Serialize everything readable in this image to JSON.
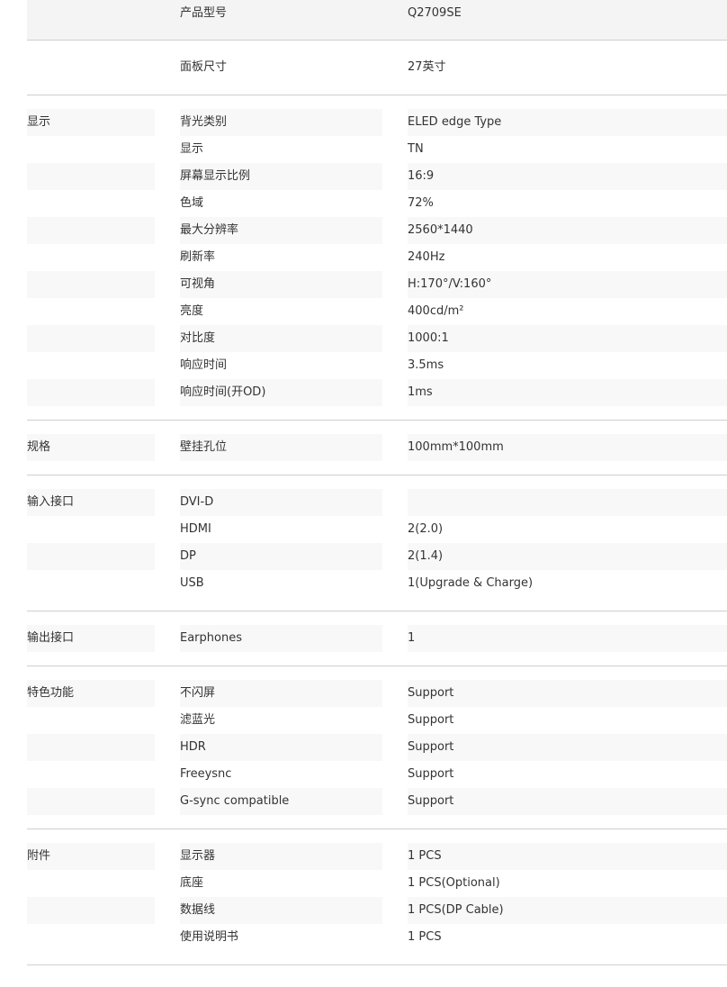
{
  "top_row": {
    "label": "产品型号",
    "value": "Q2709SE"
  },
  "panel_row": {
    "label": "面板尺寸",
    "value": "27英寸"
  },
  "sections": [
    {
      "category": "显示",
      "rows": [
        {
          "label": "背光类别",
          "value": "ELED edge Type"
        },
        {
          "label": "显示",
          "value": "TN"
        },
        {
          "label": "屏幕显示比例",
          "value": "16:9"
        },
        {
          "label": "色域",
          "value": "72%"
        },
        {
          "label": "最大分辨率",
          "value": "2560*1440"
        },
        {
          "label": "刷新率",
          "value": "240Hz"
        },
        {
          "label": "可视角",
          "value": "H:170°/V:160°"
        },
        {
          "label": "亮度",
          "value": "400cd/m²"
        },
        {
          "label": "对比度",
          "value": "1000:1"
        },
        {
          "label": "响应时间",
          "value": "3.5ms"
        },
        {
          "label": "响应时间(开OD)",
          "value": "1ms"
        }
      ]
    },
    {
      "category": "规格",
      "rows": [
        {
          "label": "壁挂孔位",
          "value": "100mm*100mm"
        }
      ]
    },
    {
      "category": "输入接口",
      "rows": [
        {
          "label": "DVI-D",
          "value": ""
        },
        {
          "label": "HDMI",
          "value": "2(2.0)"
        },
        {
          "label": "DP",
          "value": "2(1.4)"
        },
        {
          "label": "USB",
          "value": "1(Upgrade & Charge)"
        }
      ]
    },
    {
      "category": "输出接口",
      "rows": [
        {
          "label": "Earphones",
          "value": "1"
        }
      ]
    },
    {
      "category": "特色功能",
      "rows": [
        {
          "label": "不闪屏",
          "value": "Support"
        },
        {
          "label": "滤蓝光",
          "value": "Support"
        },
        {
          "label": "HDR",
          "value": "Support"
        },
        {
          "label": "Freeysnc",
          "value": "Support"
        },
        {
          "label": "G-sync compatible",
          "value": "Support"
        }
      ]
    },
    {
      "category": "附件",
      "rows": [
        {
          "label": "显示器",
          "value": "1 PCS"
        },
        {
          "label": "底座",
          "value": "1 PCS(Optional)"
        },
        {
          "label": "数据线",
          "value": "1 PCS(DP Cable)"
        },
        {
          "label": "使用说明书",
          "value": "1 PCS"
        }
      ]
    }
  ]
}
